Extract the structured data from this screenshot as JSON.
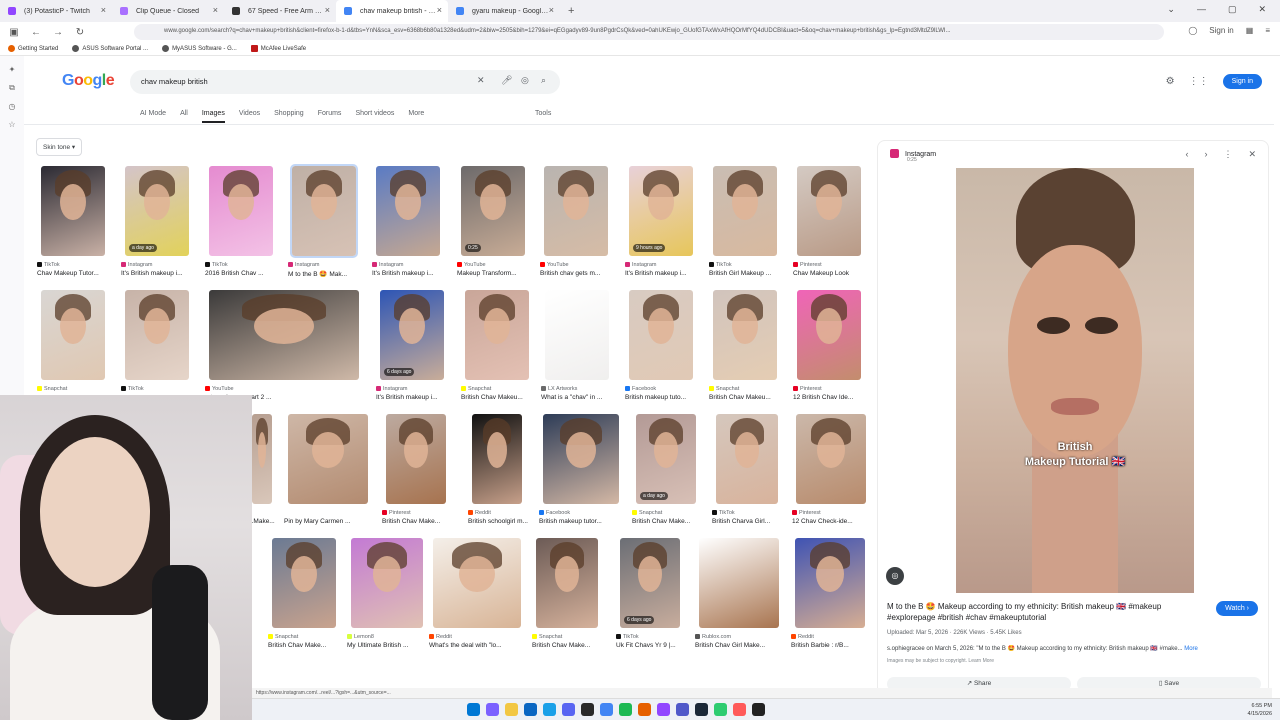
{
  "browser": {
    "tabs": [
      {
        "label": "(3) PotasticP - Twitch",
        "color": "#9146ff"
      },
      {
        "label": "Clip Queue - Closed",
        "color": "#a970ff"
      },
      {
        "label": "67 Speed - Free Arm Speed Ch",
        "color": "#333333"
      },
      {
        "label": "chav makeup british - Google S",
        "color": "#4285f4",
        "active": true
      },
      {
        "label": "gyaru makeup - Google Search",
        "color": "#4285f4"
      }
    ],
    "url": "www.google.com/search?q=chav+makeup+british&client=firefox-b-1-d&tbs=YnN&sca_esv=6368b6b80a1328ed&udm=2&biw=2505&bih=1279&ei=qEGgadyv89-9un8PgdrCsQk&ved=0ahUKEwjo_GUofGTAxWxAfHQOrMfYQ4dUDCBI&uact=5&oq=chav+makeup+british&gs_lp=Egtnd3MtdZ9lLWI...",
    "bookmarks": [
      "Getting Started",
      "ASUS Software Portal ...",
      "MyASUS Software - G...",
      "McAfee LiveSafe"
    ],
    "profile_label": "Sign in"
  },
  "google": {
    "logo": [
      "G",
      "o",
      "o",
      "g",
      "l",
      "e"
    ],
    "query": "chav makeup british",
    "signin": "Sign in",
    "tabs": [
      "AI Mode",
      "All",
      "Images",
      "Videos",
      "Shopping",
      "Forums",
      "Short videos",
      "More"
    ],
    "tools": "Tools",
    "chip": "Skin tone"
  },
  "results_row1": [
    {
      "source": "TikTok",
      "title": "Chav Makeup Tutor...",
      "badge": "",
      "c1": "#2b2a33",
      "c2": "#c9b1a6",
      "src_color": "#111111"
    },
    {
      "source": "Instagram",
      "title": "It's British makeup i...",
      "badge": "a day ago",
      "c1": "#d4c4c9",
      "c2": "#e2d25a",
      "src_color": "#d62976"
    },
    {
      "source": "TikTok",
      "title": "2016 British Chav ...",
      "badge": "",
      "c1": "#e58bd0",
      "c2": "#f3c2e6",
      "src_color": "#111111"
    },
    {
      "source": "Instagram",
      "title": "M to the B 🤩 Mak...",
      "badge": "",
      "c1": "#bfb0a6",
      "c2": "#d7c2b5",
      "src_color": "#d62976",
      "selected": true
    },
    {
      "source": "Instagram",
      "title": "It's British makeup i...",
      "badge": "",
      "c1": "#5a7bc4",
      "c2": "#c6a891",
      "src_color": "#d62976"
    },
    {
      "source": "YouTube",
      "title": "Makeup Transform...",
      "badge": "0:25",
      "c1": "#6d6a6b",
      "c2": "#c8ac96",
      "src_color": "#ff0000"
    },
    {
      "source": "YouTube",
      "title": "British chav gets m...",
      "badge": "",
      "c1": "#b9b4b0",
      "c2": "#d6bca6",
      "src_color": "#ff0000"
    },
    {
      "source": "Instagram",
      "title": "It's British makeup i...",
      "badge": "9 hours ago",
      "c1": "#e8d1d9",
      "c2": "#e7c65a",
      "src_color": "#d62976"
    },
    {
      "source": "TikTok",
      "title": "British Girl Makeup ...",
      "badge": "",
      "c1": "#c9bdb3",
      "c2": "#d8b99f",
      "src_color": "#111111"
    },
    {
      "source": "Pinterest",
      "title": "Chav Makeup Look",
      "badge": "",
      "c1": "#d4cac3",
      "c2": "#b99a86",
      "src_color": "#e60023"
    }
  ],
  "results_row2": [
    {
      "source": "Snapchat",
      "title": "",
      "badge": "",
      "c1": "#d9d6d3",
      "c2": "#e0c8b2",
      "src_color": "#fffc00"
    },
    {
      "source": "TikTok",
      "title": "",
      "badge": "",
      "c1": "#c7b3a8",
      "c2": "#e6d5c9",
      "src_color": "#111111"
    },
    {
      "source": "YouTube",
      "title": "...ts makeover part 2 ...",
      "badge": "",
      "c1": "#3b3a3a",
      "c2": "#cfb9a8",
      "src_color": "#ff0000"
    },
    {
      "source": "Instagram",
      "title": "It's British makeup i...",
      "badge": "6 days ago",
      "c1": "#2d55b5",
      "c2": "#c9ad99",
      "src_color": "#d62976"
    },
    {
      "source": "Snapchat",
      "title": "British Chav Makeu...",
      "badge": "",
      "c1": "#c9a699",
      "c2": "#e4c1b4",
      "src_color": "#fffc00"
    },
    {
      "source": "LX Artworks",
      "title": "What is a \"chav\" in ...",
      "badge": "",
      "c1": "#ffffff",
      "c2": "#f0efee",
      "src_color": "#6b6b6b"
    },
    {
      "source": "Facebook",
      "title": "British makeup tuto...",
      "badge": "",
      "c1": "#d8cbc2",
      "c2": "#e1c9b5",
      "src_color": "#1877f2"
    },
    {
      "source": "Snapchat",
      "title": "British Chav Makeu...",
      "badge": "",
      "c1": "#d1c4bd",
      "c2": "#e5cdb3",
      "src_color": "#fffc00"
    },
    {
      "source": "Pinterest",
      "title": "12 British Chav Ide...",
      "badge": "",
      "c1": "#f064b8",
      "c2": "#c38d6d",
      "src_color": "#e60023"
    }
  ],
  "results_row3": [
    {
      "source": "",
      "title": "...Make...",
      "badge": "",
      "c1": "#b79f91",
      "c2": "#d9c7ba",
      "src_color": "#888888"
    },
    {
      "source": "",
      "title": "Pin by Mary Carmen ...",
      "badge": "",
      "c1": "#ceb7a7",
      "c2": "#b38b70",
      "src_color": "#888888"
    },
    {
      "source": "Pinterest",
      "title": "British Chav Make...",
      "badge": "",
      "c1": "#bcaaa0",
      "c2": "#a7734f",
      "src_color": "#e60023"
    },
    {
      "source": "Reddit",
      "title": "British schoolgirl m...",
      "badge": "",
      "c1": "#111111",
      "c2": "#c7a08a",
      "src_color": "#ff4500"
    },
    {
      "source": "Facebook",
      "title": "British makeup tutor...",
      "badge": "",
      "c1": "#2d3c57",
      "c2": "#d4b8a5",
      "src_color": "#1877f2"
    },
    {
      "source": "Snapchat",
      "title": "British Chav Make...",
      "badge": "a day ago",
      "c1": "#b39a96",
      "c2": "#d8c0b6",
      "src_color": "#fffc00"
    },
    {
      "source": "TikTok",
      "title": "British Charva Girl...",
      "badge": "",
      "c1": "#d5c7bd",
      "c2": "#d8b39c",
      "src_color": "#111111"
    },
    {
      "source": "Pinterest",
      "title": "12 Chav Check-ide...",
      "badge": "",
      "c1": "#cbb8aa",
      "c2": "#b88b6c",
      "src_color": "#e60023"
    }
  ],
  "results_row4": [
    {
      "source": "Snapchat",
      "title": "British Chav Make...",
      "badge": "",
      "c1": "#6b7a93",
      "c2": "#c9a38e",
      "src_color": "#fffc00"
    },
    {
      "source": "Lemon8",
      "title": "My Ultimate British ...",
      "badge": "",
      "c1": "#c37ad4",
      "c2": "#e0c1b3",
      "src_color": "#d7ff3f"
    },
    {
      "source": "Reddit",
      "title": "What's the deal with \"lo...",
      "badge": "",
      "c1": "#f4efe9",
      "c2": "#d8b496",
      "src_color": "#ff4500"
    },
    {
      "source": "Snapchat",
      "title": "British Chav Make...",
      "badge": "",
      "c1": "#6c5b56",
      "c2": "#d5b19b",
      "src_color": "#fffc00"
    },
    {
      "source": "TikTok",
      "title": "Uk Fit Chavs Yr 9 |...",
      "badge": "6 days ago",
      "c1": "#6b6e75",
      "c2": "#c8ad9d",
      "src_color": "#111111"
    },
    {
      "source": "Rublox.com",
      "title": "British Chav Girl Make...",
      "badge": "",
      "c1": "#ffffff",
      "c2": "#a8744f",
      "src_color": "#555555"
    },
    {
      "source": "Reddit",
      "title": "British Barbie : r/B...",
      "badge": "",
      "c1": "#3f53b3",
      "c2": "#d7ae93",
      "src_color": "#ff4500"
    }
  ],
  "panel": {
    "source": "Instagram",
    "time": "0:25",
    "caption_line1": "British",
    "caption_line2": "Makeup Tutorial 🇬🇧",
    "title": "M to the B 🤩 Makeup according to my ethnicity: British makeup 🇬🇧 #makeup #explorepage #british #chav #makeuptutorial",
    "watch": "Watch",
    "meta": "Uploaded: Mar 5, 2026 · 226K Views · 5.45K Likes",
    "desc": "s.ophiegracee on March 5, 2026: \"M to the B 🤩 Makeup according to my ethnicity: British makeup 🇬🇧 #make...",
    "more": "More",
    "copyright": "Images may be subject to copyright. Learn More",
    "share": "Share",
    "save": "Save"
  },
  "status_url": "https://www.instagram.com/...reel/...?igsh=...&utm_source=...",
  "clock": {
    "time": "6:55 PM",
    "date": "4/15/2026"
  }
}
